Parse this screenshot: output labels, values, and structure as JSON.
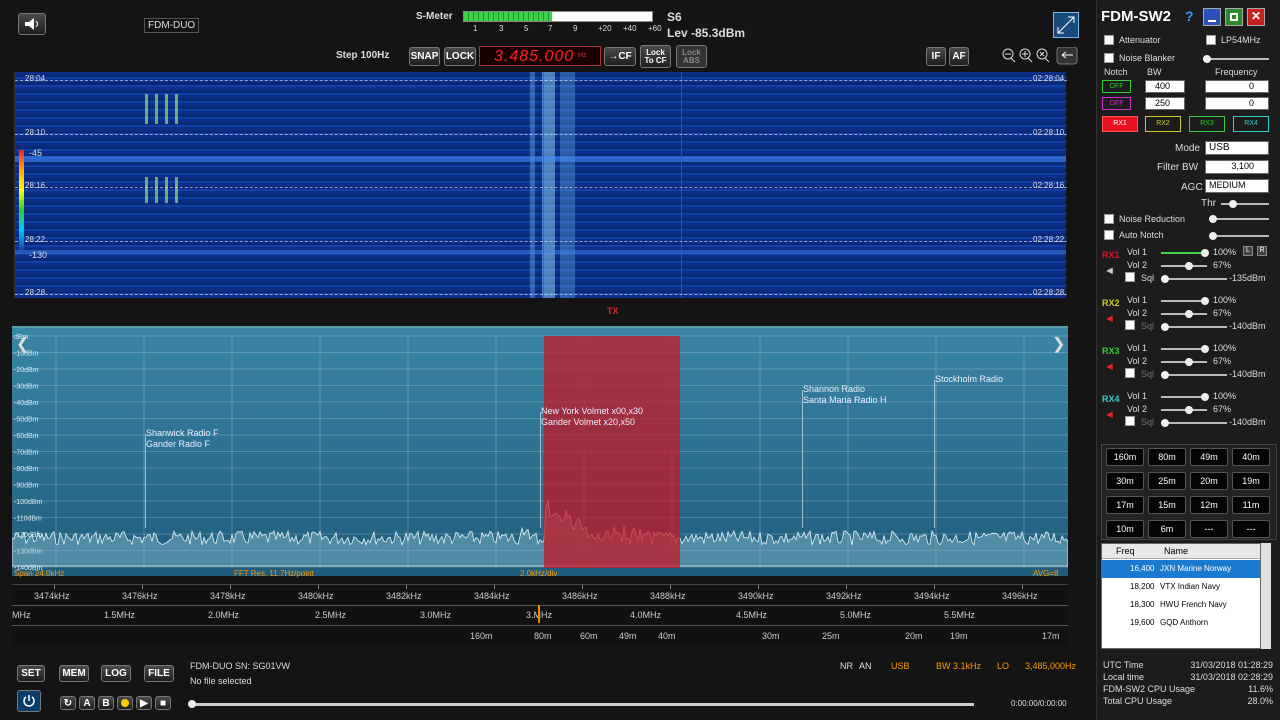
{
  "top": {
    "device": "FDM-DUO",
    "smeter_label": "S-Meter",
    "smeter_scale": [
      "1",
      "3",
      "5",
      "7",
      "9",
      "+20",
      "+40",
      "+60"
    ],
    "s_value": "S6",
    "level": "Lev -85.3dBm"
  },
  "toolbar": {
    "step": "Step 100Hz",
    "snap": "SNAP",
    "lock": "LOCK",
    "frequency": "3.485.000",
    "freq_unit": "Hz",
    "cf": "→CF",
    "lock_to_cf": "Lock To CF",
    "lock_abs": "Lock ABS",
    "if": "IF",
    "af": "AF"
  },
  "waterfall": {
    "times_left": [
      "28:04",
      "28:10",
      "28:16",
      "28:22",
      "28:28"
    ],
    "times_right": [
      "02:28:04",
      "02:28:10",
      "02:28:16",
      "02:28:22",
      "02:28:28"
    ],
    "scale_hi": "-45",
    "scale_lo": "-130",
    "tx": "TX"
  },
  "spectrum": {
    "db_labels": [
      "dBm",
      "-10dBm",
      "-20dBm",
      "-30dBm",
      "-40dBm",
      "-50dBm",
      "-60dBm",
      "-70dBm",
      "-80dBm",
      "-90dBm",
      "-100dBm",
      "-110dBm",
      "-120dBm",
      "-130dBm",
      "-140dBm"
    ],
    "stations": [
      {
        "line1": "Shanwick Radio F",
        "line2": "Gander Radio F"
      },
      {
        "line1": "New York Volmet x00,x30",
        "line2": "Gander Volmet x20,x50"
      },
      {
        "line1": "Shannon Radio",
        "line2": "Santa Maria Radio H"
      },
      {
        "line1": "Stockholm Radio",
        "line2": ""
      }
    ],
    "span": "Span 24.0kHz",
    "fft": "FFT Res. 11.7Hz/point",
    "div": "2.0kHz/div",
    "avg": "AVG=8"
  },
  "scale": {
    "khz": [
      "3474kHz",
      "3476kHz",
      "3478kHz",
      "3480kHz",
      "3482kHz",
      "3484kHz",
      "3486kHz",
      "3488kHz",
      "3490kHz",
      "3492kHz",
      "3494kHz",
      "3496kHz"
    ],
    "mhz": [
      "MHz",
      "1.5MHz",
      "2.0MHz",
      "2.5MHz",
      "3.0MHz",
      "3.MHz",
      "4.0MHz",
      "4.5MHz",
      "5.0MHz",
      "5.5MHz"
    ],
    "meters": [
      "160m",
      "80m",
      "60m",
      "49m",
      "40m",
      "30m",
      "25m",
      "20m",
      "19m",
      "17m"
    ]
  },
  "bottom": {
    "set": "SET",
    "mem": "MEM",
    "log": "LOG",
    "file": "FILE",
    "device_sn": "FDM-DUO SN: SG01VW",
    "file_status": "No file selected",
    "nr": "NR",
    "an": "AN",
    "mode": "USB",
    "bw": "BW 3.1kHz",
    "lo": "LO",
    "lo_freq": "3,485,000Hz",
    "time": "0:00:00/0:00:00",
    "play_btns": [
      "A",
      "B"
    ]
  },
  "right": {
    "title": "FDM-SW2",
    "help": "?",
    "attenuator": "Attenuator",
    "lp54": "LP54MHz",
    "noise_blanker": "Noise Blanker",
    "notch": "Notch",
    "bw": "BW",
    "frequency": "Frequency",
    "notch_rows": [
      {
        "state": "OFF",
        "bw": "400",
        "freq": "0"
      },
      {
        "state": "OFF",
        "bw": "250",
        "freq": "0"
      }
    ],
    "rx_buttons": [
      "RX1",
      "RX2",
      "RX3",
      "RX4"
    ],
    "mode_lbl": "Mode",
    "mode": "USB",
    "filter_lbl": "Filter BW",
    "filter": "3,100",
    "agc_lbl": "AGC",
    "agc": "MEDIUM",
    "thr": "Thr",
    "nr": "Noise Reduction",
    "auto_notch": "Auto Notch",
    "rx": [
      {
        "name": "RX1",
        "vol1": "100%",
        "vol2": "67%",
        "sql": "-135dBm"
      },
      {
        "name": "RX2",
        "vol1": "100%",
        "vol2": "67%",
        "sql": "-140dBm"
      },
      {
        "name": "RX3",
        "vol1": "100%",
        "vol2": "67%",
        "sql": "-140dBm"
      },
      {
        "name": "RX4",
        "vol1": "100%",
        "vol2": "67%",
        "sql": "-140dBm"
      }
    ],
    "vol1": "Vol 1",
    "vol2": "Vol 2",
    "sql": "Sql",
    "lr": [
      "L",
      "R"
    ],
    "bands": [
      "160m",
      "80m",
      "49m",
      "40m",
      "30m",
      "25m",
      "20m",
      "19m",
      "17m",
      "15m",
      "12m",
      "11m",
      "10m",
      "6m",
      "---",
      "---"
    ],
    "mem_headers": [
      "Freq",
      "Name"
    ],
    "mem": [
      {
        "freq": "16,400",
        "name": "JXN Marine Norway"
      },
      {
        "freq": "18,200",
        "name": "VTX Indian Navy"
      },
      {
        "freq": "18,300",
        "name": "HWU French Navy"
      },
      {
        "freq": "19,600",
        "name": "GQD Anthorn"
      }
    ],
    "status": [
      {
        "label": "UTC Time",
        "value": "31/03/2018 01:28:29"
      },
      {
        "label": "Local time",
        "value": "31/03/2018 02:28:29"
      },
      {
        "label": "FDM-SW2 CPU Usage",
        "value": "11.6%"
      },
      {
        "label": "Total CPU Usage",
        "value": "28.0%"
      }
    ]
  },
  "colors": {
    "spectrum_bg": "#2a6e8e",
    "passband": "#b21f2c",
    "accent_red": "#e8112d",
    "smeter_green": "#3cd24a"
  }
}
